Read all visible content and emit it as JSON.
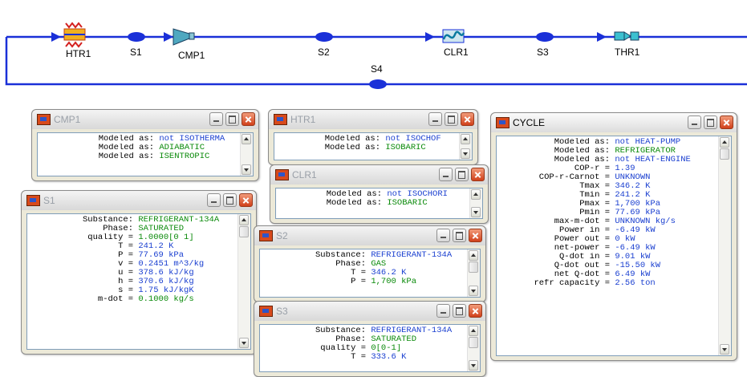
{
  "diagram": {
    "labels": {
      "htr1": "HTR1",
      "s1": "S1",
      "cmp1": "CMP1",
      "s2": "S2",
      "s4": "S4",
      "clr1": "CLR1",
      "s3": "S3",
      "thr1": "THR1"
    },
    "line_color": "#1a30d8"
  },
  "windows": {
    "cmp1": {
      "title": "CMP1",
      "lines": [
        {
          "k": "Modeled as:",
          "v": "not ISOTHERMA",
          "c": "b"
        },
        {
          "k": "Modeled as:",
          "v": "ADIABATIC",
          "c": "g"
        },
        {
          "k": "Modeled as:",
          "v": "ISENTROPIC",
          "c": "g"
        }
      ]
    },
    "s1": {
      "title": "S1",
      "lines": [
        {
          "k": "Substance:",
          "v": "REFRIGERANT-134A",
          "c": "g"
        },
        {
          "k": "Phase:",
          "v": "SATURATED",
          "c": "g"
        },
        {
          "k": "quality =",
          "v": "1.0000[0 1]",
          "c": "g"
        },
        {
          "k": "T =",
          "v": "241.2 K",
          "c": "b"
        },
        {
          "k": "P =",
          "v": "77.69 kPa",
          "c": "b"
        },
        {
          "k": "v =",
          "v": "0.2451 m^3/kg",
          "c": "b"
        },
        {
          "k": "u =",
          "v": "378.6 kJ/kg",
          "c": "b"
        },
        {
          "k": "h =",
          "v": "370.6 kJ/kg",
          "c": "b"
        },
        {
          "k": "s =",
          "v": "1.75 kJ/kgK",
          "c": "b"
        },
        {
          "k": "m-dot =",
          "v": "0.1000 kg/s",
          "c": "g"
        }
      ]
    },
    "htr1": {
      "title": "HTR1",
      "lines": [
        {
          "k": "Modeled as:",
          "v": "not ISOCHOF",
          "c": "b"
        },
        {
          "k": "Modeled as:",
          "v": "ISOBARIC",
          "c": "g"
        }
      ]
    },
    "clr1": {
      "title": "CLR1",
      "lines": [
        {
          "k": "Modeled as:",
          "v": "not ISOCHORI",
          "c": "b"
        },
        {
          "k": "Modeled as:",
          "v": "ISOBARIC",
          "c": "g"
        }
      ]
    },
    "s2": {
      "title": "S2",
      "lines": [
        {
          "k": "Substance:",
          "v": "REFRIGERANT-134A",
          "c": "b"
        },
        {
          "k": "Phase:",
          "v": "GAS",
          "c": "g"
        },
        {
          "k": "T =",
          "v": "346.2 K",
          "c": "b"
        },
        {
          "k": "P =",
          "v": "1,700 kPa",
          "c": "g"
        }
      ]
    },
    "s3": {
      "title": "S3",
      "lines": [
        {
          "k": "Substance:",
          "v": "REFRIGERANT-134A",
          "c": "b"
        },
        {
          "k": "Phase:",
          "v": "SATURATED",
          "c": "g"
        },
        {
          "k": "quality =",
          "v": "0[0-1]",
          "c": "g"
        },
        {
          "k": "T =",
          "v": "333.6 K",
          "c": "b"
        }
      ]
    },
    "cycle": {
      "title": "CYCLE",
      "lines": [
        {
          "k": "Modeled as:",
          "v": "not HEAT-PUMP",
          "c": "b"
        },
        {
          "k": "Modeled as:",
          "v": "REFRIGERATOR",
          "c": "g"
        },
        {
          "k": "Modeled as:",
          "v": "not HEAT-ENGINE",
          "c": "b"
        },
        {
          "k": "COP-r =",
          "v": "1.39",
          "c": "b"
        },
        {
          "k": "COP-r-Carnot =",
          "v": "UNKNOWN",
          "c": "b"
        },
        {
          "k": "Tmax =",
          "v": "346.2 K",
          "c": "b"
        },
        {
          "k": "Tmin =",
          "v": "241.2 K",
          "c": "b"
        },
        {
          "k": "Pmax =",
          "v": "1,700 kPa",
          "c": "b"
        },
        {
          "k": "Pmin =",
          "v": "77.69 kPa",
          "c": "b"
        },
        {
          "k": "max-m-dot =",
          "v": "UNKNOWN kg/s",
          "c": "b"
        },
        {
          "k": "Power in =",
          "v": "-6.49 kW",
          "c": "b"
        },
        {
          "k": "Power out =",
          "v": "0 kW",
          "c": "b"
        },
        {
          "k": "net-power =",
          "v": "-6.49 kW",
          "c": "b"
        },
        {
          "k": "Q-dot in =",
          "v": "9.01 kW",
          "c": "b"
        },
        {
          "k": "Q-dot out =",
          "v": "-15.50 kW",
          "c": "b"
        },
        {
          "k": "net Q-dot =",
          "v": "6.49 kW",
          "c": "b"
        },
        {
          "k": "refr capacity =",
          "v": "2.56 ton",
          "c": "b"
        }
      ]
    }
  }
}
